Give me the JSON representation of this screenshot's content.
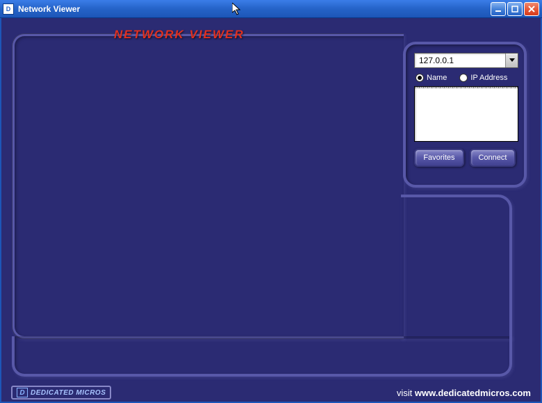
{
  "window": {
    "title": "Network Viewer",
    "icon_label": "D"
  },
  "viewer": {
    "title": "NETWORK VIEWER"
  },
  "connection": {
    "ip_value": "127.0.0.1",
    "radio_name_label": "Name",
    "radio_ip_label": "IP Address",
    "selected_radio": "name",
    "favorites_label": "Favorites",
    "connect_label": "Connect"
  },
  "footer": {
    "logo_icon": "D",
    "logo_text": "DEDICATED MICROS",
    "visit_label": "visit ",
    "url": "www.dedicatedmicros.com"
  }
}
